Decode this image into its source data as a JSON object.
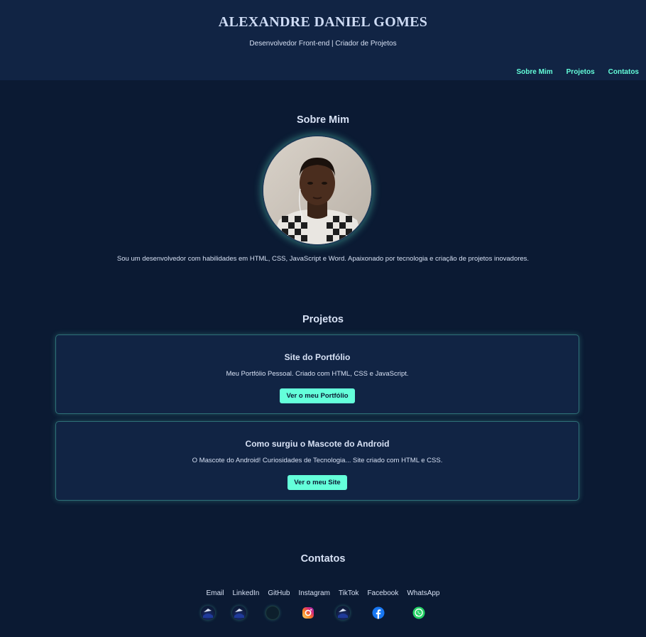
{
  "header": {
    "title": "ALEXANDRE DANIEL GOMES",
    "subtitle": "Desenvolvedor Front-end | Criador de Projetos"
  },
  "nav": {
    "items": [
      {
        "label": "Sobre Mim"
      },
      {
        "label": "Projetos"
      },
      {
        "label": "Contatos"
      }
    ]
  },
  "about": {
    "heading": "Sobre Mim",
    "text": "Sou um desenvolvedor com habilidades em HTML, CSS, JavaScript e Word. Apaixonado por tecnologia e criação de projetos inovadores."
  },
  "projects": {
    "heading": "Projetos",
    "items": [
      {
        "title": "Site do Portfólio",
        "description": "Meu Portfólio Pessoal. Criado com HTML, CSS e JavaScript.",
        "button": "Ver o meu Portfólio"
      },
      {
        "title": "Como surgiu o Mascote do Android",
        "description": "O Mascote do Android! Curiosidades de Tecnologia... Site criado com HTML e CSS.",
        "button": "Ver o meu Site"
      }
    ]
  },
  "contacts": {
    "heading": "Contatos",
    "links": [
      {
        "label": "Email",
        "icon": "broken-image-icon"
      },
      {
        "label": "LinkedIn",
        "icon": "broken-image-icon"
      },
      {
        "label": "GitHub",
        "icon": "github-icon"
      },
      {
        "label": "Instagram",
        "icon": "instagram-icon"
      },
      {
        "label": "TikTok",
        "icon": "broken-image-icon"
      },
      {
        "label": "Facebook",
        "icon": "facebook-icon"
      },
      {
        "label": "WhatsApp",
        "icon": "whatsapp-icon"
      }
    ]
  },
  "colors": {
    "background": "#0b1a33",
    "header": "#112444",
    "accent": "#64ffda",
    "text": "#d8e2f5"
  }
}
